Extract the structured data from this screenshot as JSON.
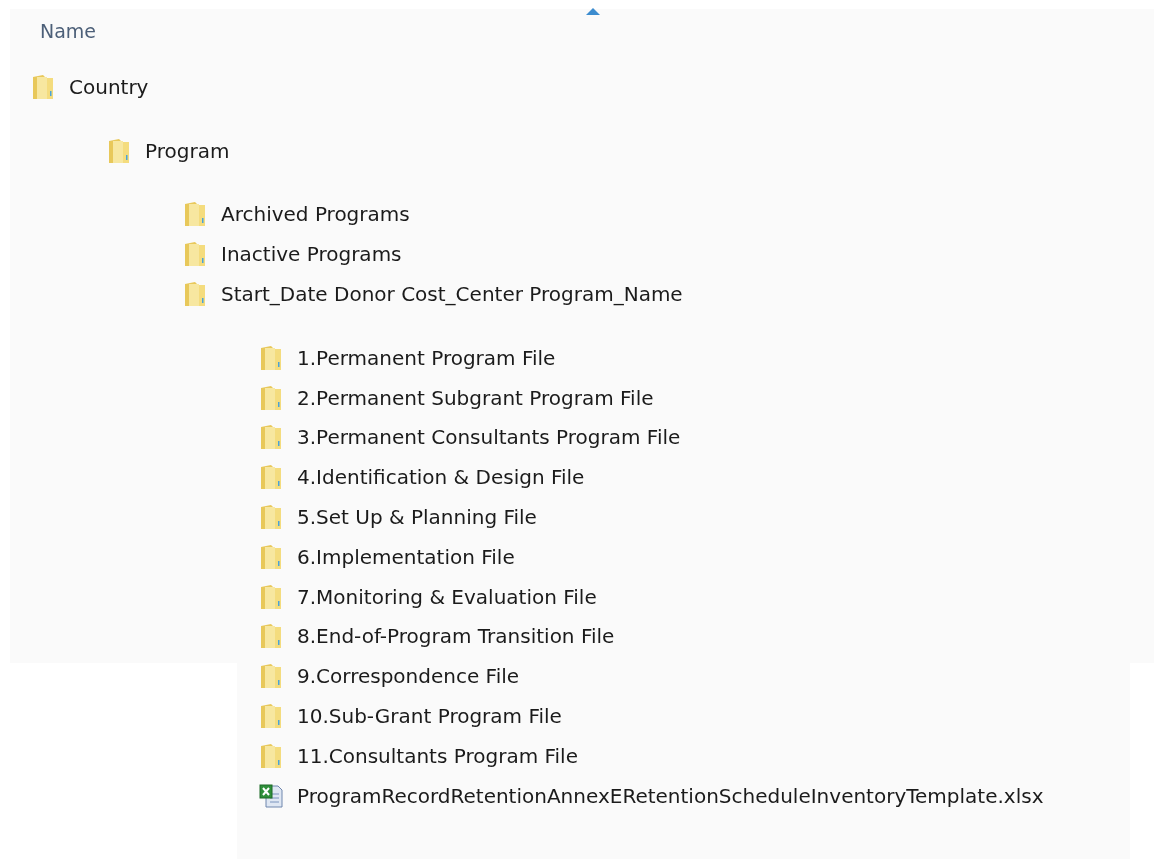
{
  "column_header": {
    "label": "Name",
    "sort_ascending": true
  },
  "tree": [
    {
      "kind": "folder",
      "name": "Country",
      "children": [
        {
          "kind": "folder",
          "name": "Program",
          "children": [
            {
              "kind": "folder",
              "name": "Archived Programs"
            },
            {
              "kind": "folder",
              "name": "Inactive Programs"
            },
            {
              "kind": "folder",
              "name": "Start_Date Donor Cost_Center Program_Name",
              "children": [
                {
                  "kind": "folder",
                  "name": "1.Permanent Program File"
                },
                {
                  "kind": "folder",
                  "name": "2.Permanent Subgrant Program File"
                },
                {
                  "kind": "folder",
                  "name": "3.Permanent Consultants Program File"
                },
                {
                  "kind": "folder",
                  "name": "4.Identification & Design File"
                },
                {
                  "kind": "folder",
                  "name": "5.Set Up & Planning File"
                },
                {
                  "kind": "folder",
                  "name": "6.Implementation File"
                },
                {
                  "kind": "folder",
                  "name": "7.Monitoring & Evaluation File"
                },
                {
                  "kind": "folder",
                  "name": "8.End-of-Program Transition File"
                },
                {
                  "kind": "folder",
                  "name": "9.Correspondence File"
                },
                {
                  "kind": "folder",
                  "name": "10.Sub-Grant Program File"
                },
                {
                  "kind": "folder",
                  "name": "11.Consultants Program File"
                },
                {
                  "kind": "excel",
                  "name": "ProgramRecordRetentionAnnexERetentionScheduleInventoryTemplate.xlsx"
                }
              ]
            }
          ]
        }
      ]
    }
  ]
}
